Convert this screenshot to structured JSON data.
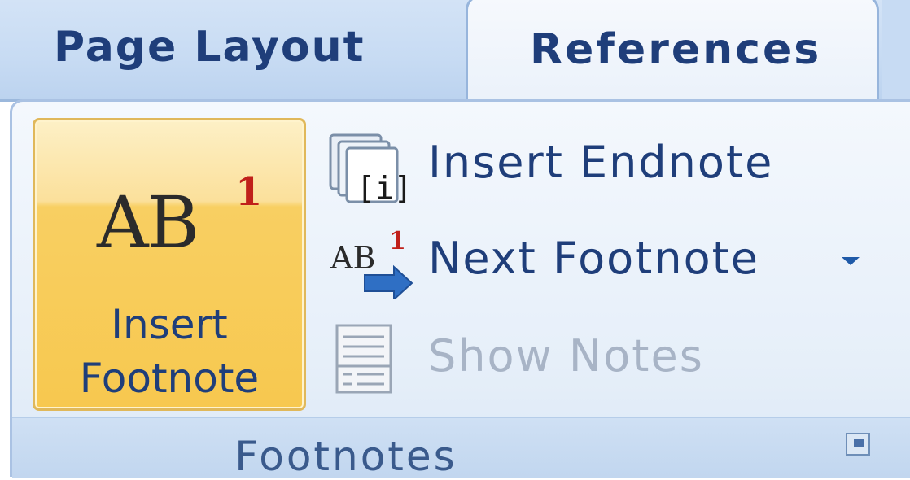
{
  "tabs": {
    "page_layout": "Page Layout",
    "references": "References"
  },
  "group": {
    "title": "Footnotes",
    "launcher_icon": "dialog-launcher-icon"
  },
  "buttons": {
    "insert_footnote": {
      "line1": "Insert",
      "line2": "Footnote",
      "icon": "insert-footnote-icon",
      "icon_text": "AB",
      "icon_superscript": "1"
    },
    "insert_endnote": {
      "label": "Insert Endnote",
      "icon": "insert-endnote-icon",
      "icon_text": "[i]"
    },
    "next_footnote": {
      "label": "Next Footnote",
      "icon": "next-footnote-icon",
      "icon_text": "AB",
      "icon_superscript": "1"
    },
    "show_notes": {
      "label": "Show Notes",
      "icon": "show-notes-icon",
      "disabled": true
    }
  },
  "colors": {
    "accent_text": "#1f3e7a",
    "hover_gold": "#f7c84f",
    "superscript_red": "#c0201a",
    "disabled_text": "#a8b4c6"
  }
}
